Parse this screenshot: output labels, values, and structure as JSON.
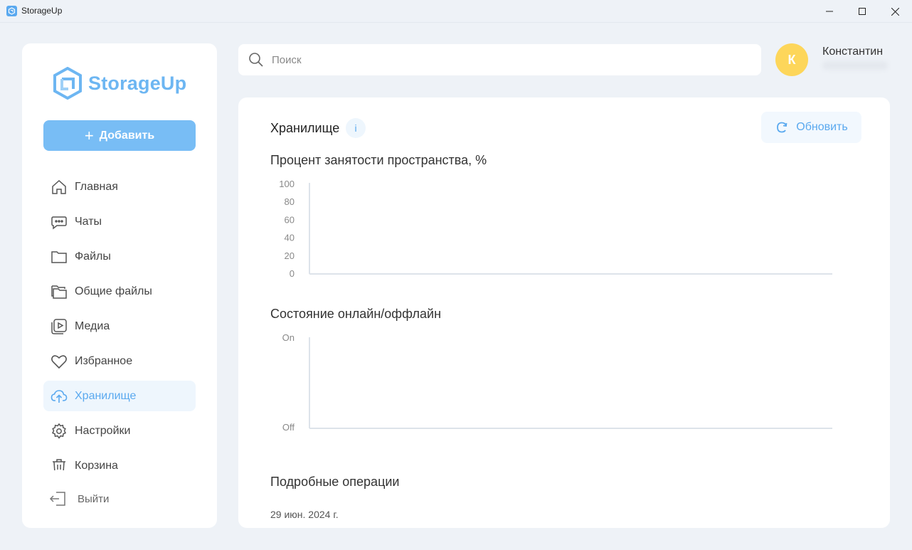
{
  "window": {
    "title": "StorageUp"
  },
  "sidebar": {
    "logo_text": "StorageUp",
    "add_button_label": "Добавить",
    "items": [
      {
        "label": "Главная",
        "icon": "home-icon"
      },
      {
        "label": "Чаты",
        "icon": "chat-icon"
      },
      {
        "label": "Файлы",
        "icon": "folder-icon"
      },
      {
        "label": "Общие файлы",
        "icon": "shared-folder-icon"
      },
      {
        "label": "Медиа",
        "icon": "media-icon"
      },
      {
        "label": "Избранное",
        "icon": "heart-icon"
      },
      {
        "label": "Хранилище",
        "icon": "cloud-upload-icon",
        "active": true
      },
      {
        "label": "Настройки",
        "icon": "gear-icon"
      },
      {
        "label": "Корзина",
        "icon": "trash-icon"
      }
    ],
    "logout_label": "Выйти"
  },
  "search": {
    "placeholder": "Поиск",
    "value": ""
  },
  "user": {
    "avatar_letter": "К",
    "name": "Константин"
  },
  "main": {
    "title": "Хранилище",
    "info_label": "i",
    "refresh_label": "Обновить",
    "usage_title": "Процент занятости пространства, %",
    "status_title": "Состояние онлайн/оффлайн",
    "operations_title": "Подробные операции",
    "operations_date": "29 июн. 2024 г."
  },
  "colors": {
    "accent": "#5aa9ef",
    "add_button": "#78bdf5",
    "avatar": "#fdd65a",
    "background": "#eef2f7"
  },
  "chart_data": [
    {
      "type": "line",
      "title": "Процент занятости пространства, %",
      "y_ticks": [
        "100",
        "80",
        "60",
        "40",
        "20",
        "0"
      ],
      "ylim": [
        0,
        100
      ],
      "series": []
    },
    {
      "type": "line",
      "title": "Состояние онлайн/оффлайн",
      "y_ticks": [
        "On",
        "Off"
      ],
      "series": []
    }
  ]
}
